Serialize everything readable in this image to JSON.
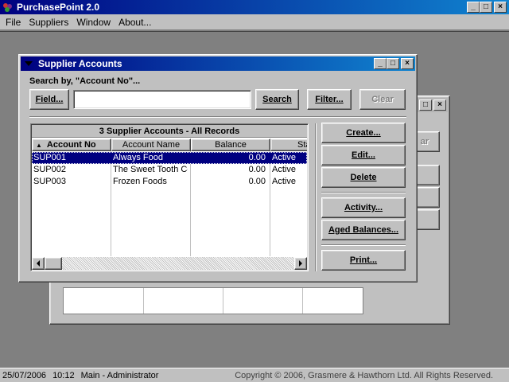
{
  "app": {
    "title": "PurchasePoint 2.0"
  },
  "menu": [
    "File",
    "Suppliers",
    "Window",
    "About..."
  ],
  "caption_buttons": {
    "minimize": "_",
    "maximize": "□",
    "close": "×"
  },
  "bg_window": {
    "clear_label": "ar"
  },
  "dialog": {
    "title": "Supplier Accounts",
    "search_by_label": "Search by, \"Account No\"...",
    "field_button": "Field...",
    "search_value": "",
    "search_button": "Search",
    "filter_button": "Filter...",
    "clear_button": "Clear",
    "grid_caption": "3 Supplier Accounts - All Records",
    "columns": [
      "Account No",
      "Account Name",
      "Balance",
      "Status"
    ],
    "sort_indicator": "▲",
    "rows": [
      {
        "account_no": "SUP001",
        "account_name": "Always Food",
        "balance": "0.00",
        "status": "Active",
        "selected": true
      },
      {
        "account_no": "SUP002",
        "account_name": "The Sweet Tooth Co",
        "balance": "0.00",
        "status": "Active",
        "selected": false
      },
      {
        "account_no": "SUP003",
        "account_name": "Frozen Foods",
        "balance": "0.00",
        "status": "Active",
        "selected": false
      }
    ],
    "buttons": {
      "create": "Create...",
      "edit": "Edit...",
      "delete": "Delete",
      "activity": "Activity...",
      "aged_balances": "Aged Balances...",
      "print": "Print..."
    }
  },
  "status_bar": {
    "date": "25/07/2006",
    "time": "10:12",
    "user": "Main - Administrator",
    "copyright": "Copyright © 2006, Grasmere & Hawthorn Ltd. All Rights Reserved."
  },
  "colors": {
    "title_active": "#000080",
    "selection": "#000080",
    "desktop": "#808080",
    "face": "#c0c0c0"
  }
}
